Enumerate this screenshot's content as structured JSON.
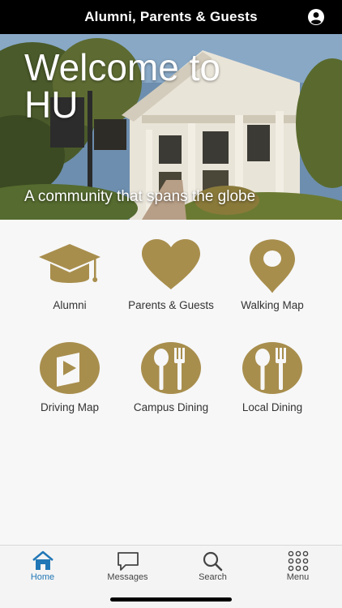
{
  "header": {
    "title": "Alumni, Parents & Guests",
    "profile_icon": "account-circle-icon"
  },
  "hero": {
    "title": "Welcome to HU",
    "subtitle": "A community that spans the globe"
  },
  "tiles": [
    {
      "label": "Alumni",
      "icon": "graduation-cap-icon"
    },
    {
      "label": "Parents & Guests",
      "icon": "heart-icon"
    },
    {
      "label": "Walking Map",
      "icon": "map-pin-icon"
    },
    {
      "label": "Driving Map",
      "icon": "driving-map-icon"
    },
    {
      "label": "Campus Dining",
      "icon": "spoon-fork-icon"
    },
    {
      "label": "Local Dining",
      "icon": "spoon-fork-icon"
    }
  ],
  "tabbar": {
    "items": [
      {
        "label": "Home",
        "icon": "home-icon",
        "active": true
      },
      {
        "label": "Messages",
        "icon": "speech-bubble-icon",
        "active": false
      },
      {
        "label": "Search",
        "icon": "search-icon",
        "active": false
      },
      {
        "label": "Menu",
        "icon": "grid-dots-icon",
        "active": false
      }
    ]
  },
  "colors": {
    "accent_gold": "#a88e4d",
    "active_blue": "#2177b6",
    "header_bg": "#000000"
  }
}
